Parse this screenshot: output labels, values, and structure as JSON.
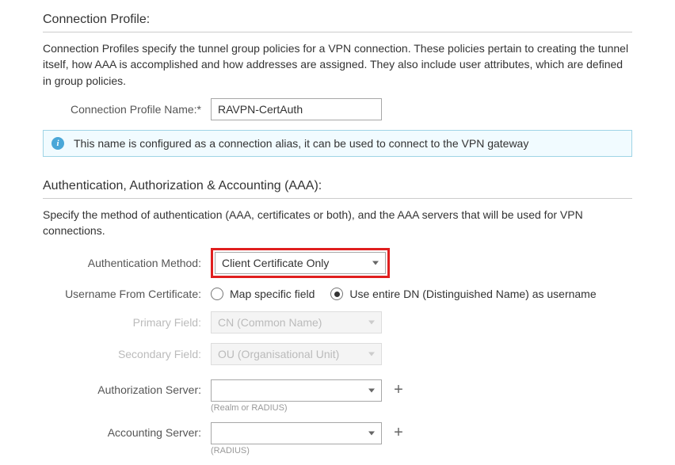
{
  "connection_profile": {
    "title": "Connection Profile:",
    "description": "Connection Profiles specify the tunnel group policies for a VPN connection. These policies pertain to creating the tunnel itself, how AAA is accomplished and how addresses are assigned. They also include user attributes, which are defined in group policies.",
    "name_label": "Connection Profile Name:*",
    "name_value": "RAVPN-CertAuth",
    "info_icon": "i",
    "info_text": "This name is configured as a connection alias, it can be used to connect to the VPN gateway"
  },
  "aaa": {
    "title": "Authentication, Authorization & Accounting (AAA):",
    "description": "Specify the method of authentication (AAA, certificates or both), and the AAA servers that will be used for VPN connections.",
    "auth_method_label": "Authentication Method:",
    "auth_method_value": "Client Certificate Only",
    "username_from_cert_label": "Username From Certificate:",
    "radio_map_specific": "Map specific field",
    "radio_entire_dn": "Use entire DN (Distinguished Name) as username",
    "primary_field_label": "Primary Field:",
    "primary_field_value": "CN (Common Name)",
    "secondary_field_label": "Secondary Field:",
    "secondary_field_value": "OU (Organisational Unit)",
    "authorization_server_label": "Authorization Server:",
    "authorization_server_value": "",
    "authorization_server_help": "(Realm or RADIUS)",
    "accounting_server_label": "Accounting Server:",
    "accounting_server_value": "",
    "accounting_server_help": "(RADIUS)",
    "plus": "+"
  }
}
